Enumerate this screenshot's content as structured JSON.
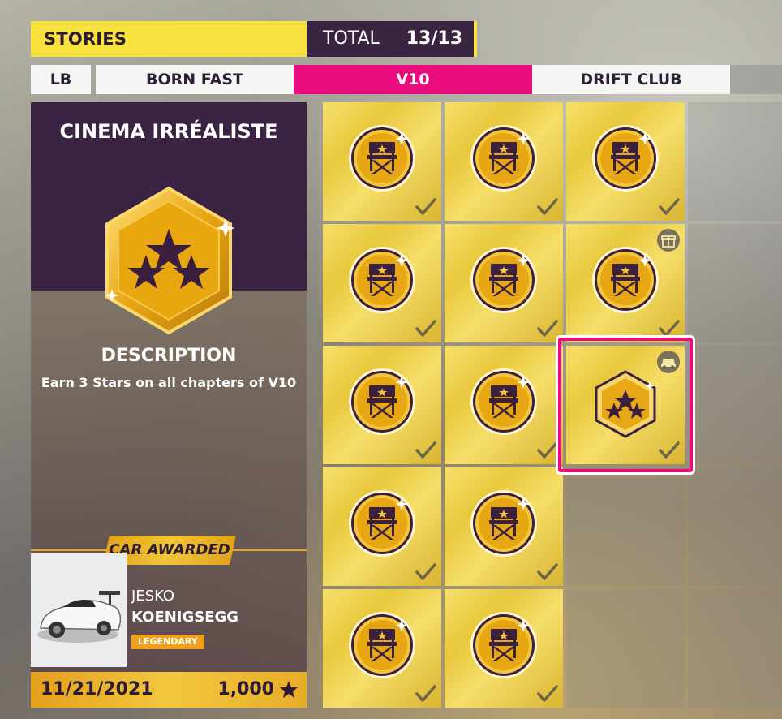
{
  "header": {
    "section_label": "STORIES",
    "total_label": "TOTAL",
    "total_value": "13/13"
  },
  "tabs": [
    {
      "label": "LB",
      "active": false
    },
    {
      "label": "BORN FAST",
      "active": false
    },
    {
      "label": "V10",
      "active": true
    },
    {
      "label": "DRIFT CLUB",
      "active": false
    }
  ],
  "detail": {
    "title": "CINEMA IRRÉALISTE",
    "badge_icon": "three-stars-hexagon-icon",
    "description_heading": "DESCRIPTION",
    "description_text": "Earn 3 Stars on all chapters of V10",
    "car_awarded_label": "CAR AWARDED",
    "car": {
      "model": "JESKO",
      "make": "KOENIGSEGG",
      "rarity": "LEGENDARY"
    },
    "date": "11/21/2021",
    "points": "1,000"
  },
  "grid": {
    "tiles": [
      {
        "icon": "director-chair-icon",
        "completed": true,
        "reward_icon": null
      },
      {
        "icon": "director-chair-icon",
        "completed": true,
        "reward_icon": null
      },
      {
        "icon": "director-chair-icon",
        "completed": true,
        "reward_icon": null
      },
      {
        "icon": "director-chair-icon",
        "completed": true,
        "reward_icon": null
      },
      {
        "icon": "director-chair-icon",
        "completed": true,
        "reward_icon": null
      },
      {
        "icon": "director-chair-icon",
        "completed": true,
        "reward_icon": "gift-icon"
      },
      {
        "icon": "director-chair-icon",
        "completed": true,
        "reward_icon": null
      },
      {
        "icon": "director-chair-icon",
        "completed": true,
        "reward_icon": null
      },
      {
        "icon": "three-stars-hexagon-icon",
        "completed": true,
        "reward_icon": "car-icon",
        "selected": true
      },
      {
        "icon": "director-chair-icon",
        "completed": true,
        "reward_icon": null
      },
      {
        "icon": "director-chair-icon",
        "completed": true,
        "reward_icon": null
      },
      {
        "icon": "director-chair-icon",
        "completed": true,
        "reward_icon": null
      },
      {
        "icon": "director-chair-icon",
        "completed": true,
        "reward_icon": null
      }
    ]
  },
  "colors": {
    "accent_yellow": "#f7e13c",
    "accent_pink": "#ec0a7f",
    "panel_purple": "#3a2343",
    "gold": "#e4a01c"
  }
}
